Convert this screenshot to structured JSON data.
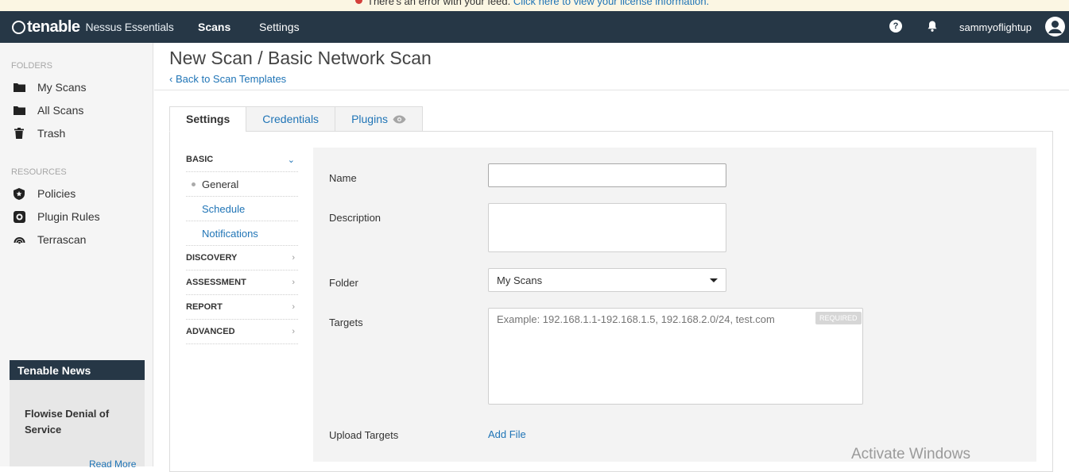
{
  "banner": {
    "text": "There's an error with your feed.",
    "link": "Click here to view your license information."
  },
  "nav": {
    "brand": "tenable",
    "product": "Nessus Essentials",
    "links": [
      "Scans",
      "Settings"
    ],
    "help_glyph": "?",
    "username": "sammyoflightup"
  },
  "sidebar": {
    "folders_heading": "FOLDERS",
    "folders": [
      {
        "label": "My Scans",
        "icon": "folder-icon"
      },
      {
        "label": "All Scans",
        "icon": "folder-icon"
      },
      {
        "label": "Trash",
        "icon": "trash-icon"
      }
    ],
    "resources_heading": "RESOURCES",
    "resources": [
      {
        "label": "Policies",
        "icon": "shield-icon"
      },
      {
        "label": "Plugin Rules",
        "icon": "plugin-rules-icon"
      },
      {
        "label": "Terrascan",
        "icon": "terrascan-icon"
      }
    ],
    "news": {
      "heading": "Tenable News",
      "title": "Flowise Denial of Service",
      "more": "Read More"
    }
  },
  "main": {
    "title": "New Scan / Basic Network Scan",
    "back_link": "Back to Scan Templates",
    "tabs": [
      {
        "label": "Settings",
        "active": true
      },
      {
        "label": "Credentials",
        "active": false
      },
      {
        "label": "Plugins",
        "active": false
      }
    ],
    "sections": {
      "basic": "BASIC",
      "basic_items": [
        "General",
        "Schedule",
        "Notifications"
      ],
      "discovery": "DISCOVERY",
      "assessment": "ASSESSMENT",
      "report": "REPORT",
      "advanced": "ADVANCED"
    },
    "form": {
      "name_label": "Name",
      "name_value": "",
      "description_label": "Description",
      "description_value": "",
      "folder_label": "Folder",
      "folder_value": "My Scans",
      "targets_label": "Targets",
      "targets_placeholder": "Example: 192.168.1.1-192.168.1.5, 192.168.2.0/24, test.com",
      "required_badge": "REQUIRED",
      "upload_label": "Upload Targets",
      "add_file": "Add File"
    }
  },
  "watermark": "Activate Windows",
  "colors": {
    "navbar": "#263746",
    "link": "#1f74b6",
    "sidebar_bg": "#f5f5f5",
    "form_bg": "#f3f3f3"
  }
}
